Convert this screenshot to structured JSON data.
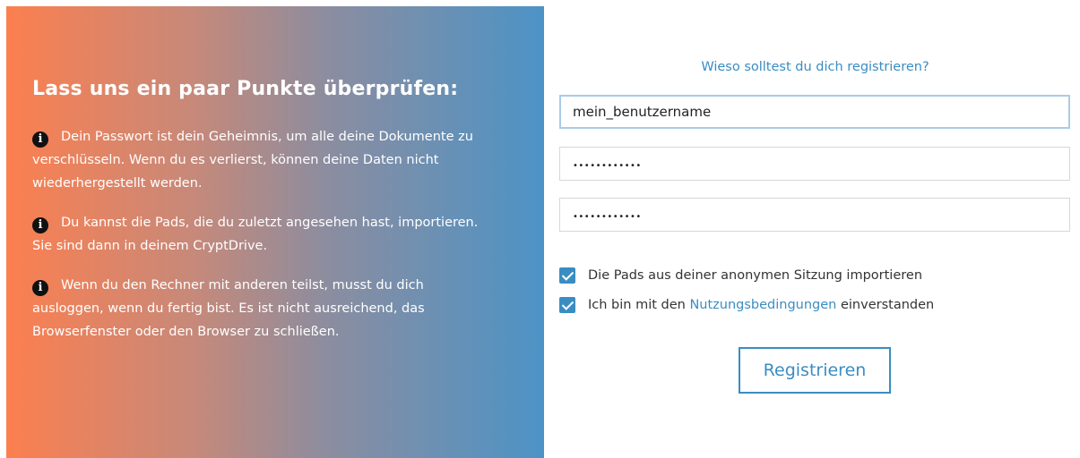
{
  "info_panel": {
    "heading": "Lass uns ein paar Punkte überprüfen:",
    "tips": [
      "Dein Passwort ist dein Geheimnis, um alle deine Dokumente zu verschlüsseln. Wenn du es verlierst, können deine Daten nicht wiederhergestellt werden.",
      "Du kannst die Pads, die du zuletzt angesehen hast, importieren. Sie sind dann in deinem CryptDrive.",
      "Wenn du den Rechner mit anderen teilst, musst du dich ausloggen, wenn du fertig bist. Es ist nicht ausreichend, das Browserfenster oder den Browser zu schließen."
    ],
    "icon": "info-circle-icon",
    "icon_glyph": "i"
  },
  "form": {
    "why_link": "Wieso solltest du dich registrieren?",
    "username_value": "mein_benutzername",
    "password_value": "••••••••••••",
    "password_confirm_value": "••••••••••••",
    "import_checkbox_label": "Die Pads aus deiner anonymen Sitzung importieren",
    "import_checked": true,
    "terms_prefix": "Ich bin mit den ",
    "terms_link": "Nutzungsbedingungen",
    "terms_suffix": " einverstanden",
    "terms_checked": true,
    "register_label": "Registrieren"
  },
  "colors": {
    "gradient_start": "#fc7f4f",
    "gradient_end": "#4c93c6",
    "accent": "#3a8dc2"
  }
}
